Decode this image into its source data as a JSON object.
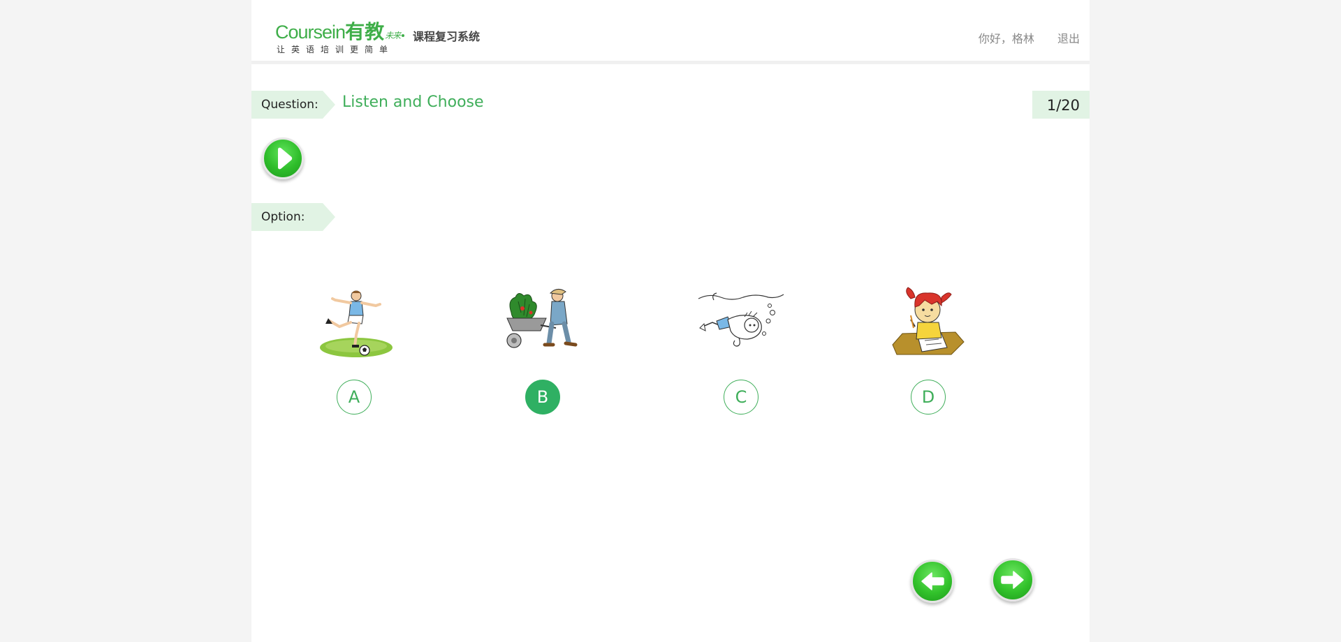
{
  "header": {
    "brand_latin": "Coursein",
    "brand_cn": "有教",
    "brand_sub": "未来",
    "system_name": "课程复习系统",
    "slogan": "让英语培训更简单",
    "greeting": "你好，格林",
    "logout": "退出"
  },
  "question": {
    "label": "Question:",
    "title": "Listen and Choose",
    "progress": "1/20",
    "current": 1,
    "total": 20
  },
  "audio": {
    "icon": "play-icon"
  },
  "options_section": {
    "label": "Option:",
    "selected": "B",
    "items": [
      {
        "letter": "A",
        "icon": "soccer-player-illustration"
      },
      {
        "letter": "B",
        "icon": "gardener-wheelbarrow-illustration"
      },
      {
        "letter": "C",
        "icon": "swimmer-underwater-illustration"
      },
      {
        "letter": "D",
        "icon": "girl-drawing-illustration"
      }
    ]
  },
  "navigation": {
    "prev_icon": "arrow-left-icon",
    "next_icon": "arrow-right-icon"
  },
  "colors": {
    "accent": "#3fae5a",
    "tag_bg": "#e1f3e4",
    "selected": "#2fb063",
    "page_bg": "#f4f4f4"
  }
}
